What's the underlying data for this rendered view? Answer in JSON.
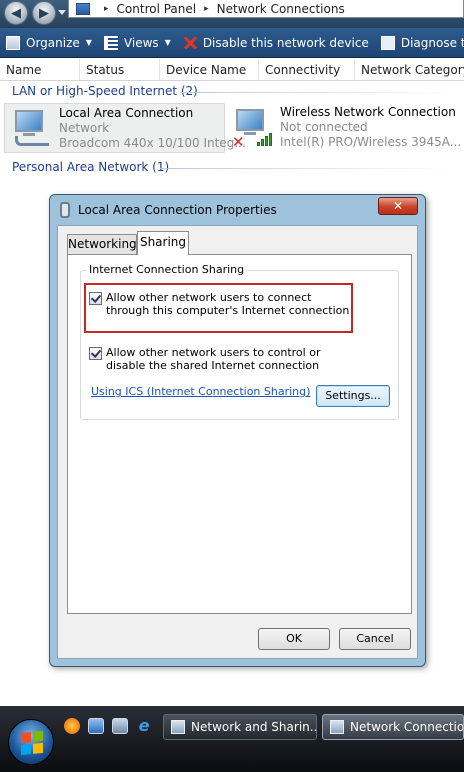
{
  "address_bar": {
    "breadcrumbs": [
      "Control Panel",
      "Network Connections"
    ],
    "separator": "▸"
  },
  "toolbar": {
    "items": [
      {
        "label": "Organize",
        "icon": "organize-icon",
        "has_dropdown": true
      },
      {
        "label": "Views",
        "icon": "views-icon",
        "has_dropdown": true
      },
      {
        "label": "Disable this network device",
        "icon": "disable-icon",
        "has_dropdown": false
      },
      {
        "label": "Diagnose this",
        "icon": "diagnose-icon",
        "has_dropdown": false
      }
    ]
  },
  "columns": [
    "Name",
    "Status",
    "Device Name",
    "Connectivity",
    "Network Category"
  ],
  "groups": [
    {
      "title": "LAN or High-Speed Internet (2)"
    },
    {
      "title": "Personal Area Network (1)"
    }
  ],
  "connections": [
    {
      "name": "Local Area Connection",
      "status": "Network",
      "device": "Broadcom 440x 10/100 Integ...",
      "icon": "wired-network-icon",
      "selected": true
    },
    {
      "name": "Wireless Network Connection",
      "status": "Not connected",
      "device": "Intel(R) PRO/Wireless 3945A...",
      "icon": "wireless-network-icon",
      "selected": false
    }
  ],
  "dialog": {
    "title": "Local Area Connection Properties",
    "close_label": "✕",
    "tabs": [
      {
        "label": "Networking",
        "active": false
      },
      {
        "label": "Sharing",
        "active": true
      }
    ],
    "group_label": "Internet Connection Sharing",
    "options": [
      {
        "label": "Allow other network users to connect through this computer's Internet connection",
        "checked": true
      },
      {
        "label": "Allow other network users to control or disable the shared Internet connection",
        "checked": true
      }
    ],
    "link_label": "Using ICS (Internet Connection Sharing)",
    "settings_label": "Settings...",
    "ok_label": "OK",
    "cancel_label": "Cancel"
  },
  "taskbar": {
    "quick_launch": [
      "firefox-icon",
      "show-desktop-icon",
      "switch-windows-icon",
      "internet-explorer-icon"
    ],
    "ie_glyph": "e",
    "tasks": [
      {
        "label": "Network and Sharin...",
        "active": false
      },
      {
        "label": "Network Connections",
        "active": true
      }
    ]
  },
  "colors": {
    "accent_highlight": "#c0282a",
    "link": "#1a55c0",
    "toolbar_bg": "#1d4574"
  }
}
